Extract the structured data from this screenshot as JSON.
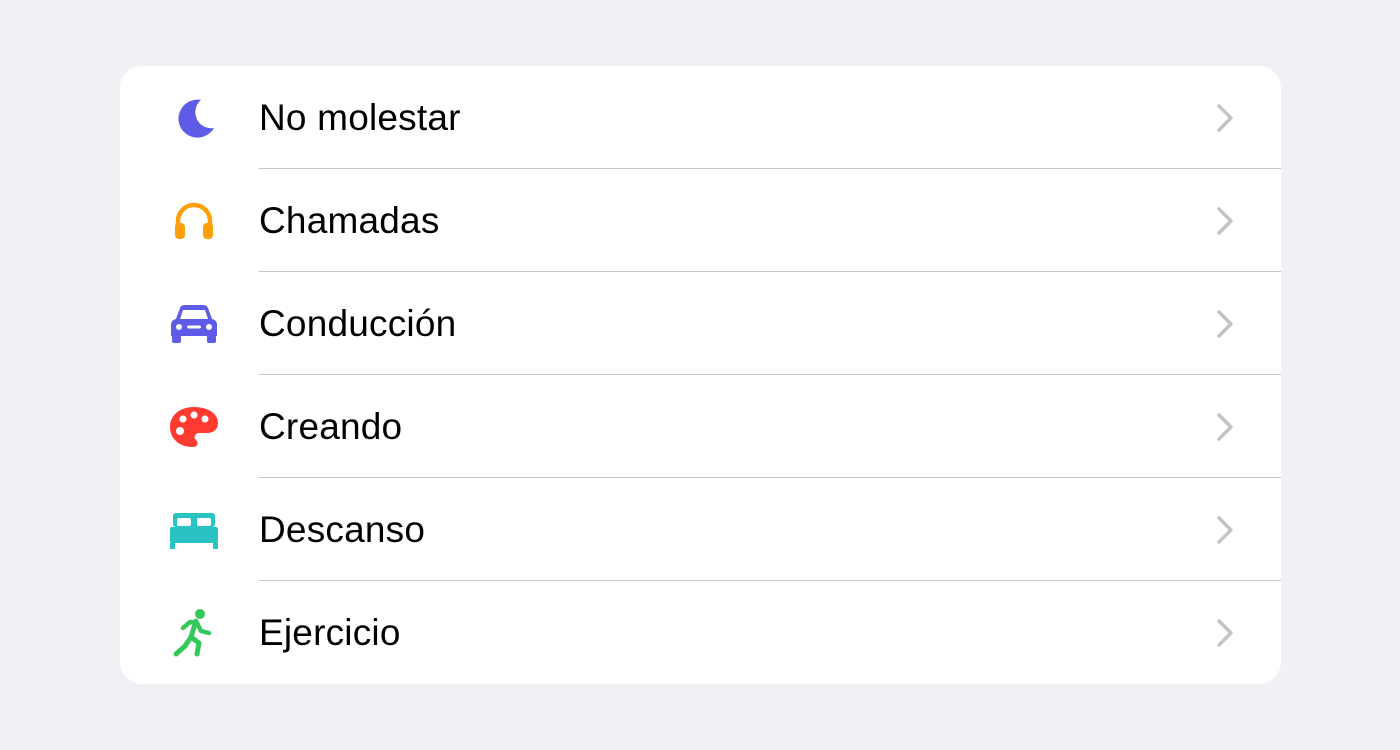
{
  "colors": {
    "background": "#f0f0f5",
    "card": "#ffffff",
    "separator": "#c8c8cc",
    "chevron": "#c4c4c7",
    "moon": "#5e5ce6",
    "headphones": "#ff9f0a",
    "car": "#5e5ce6",
    "palette": "#ff3b30",
    "bed": "#2ac3c3",
    "runner": "#34c759"
  },
  "focus_list": {
    "items": [
      {
        "label": "No molestar",
        "icon": "moon-icon"
      },
      {
        "label": "Chamadas",
        "icon": "headphones-icon"
      },
      {
        "label": "Conducción",
        "icon": "car-icon"
      },
      {
        "label": "Creando",
        "icon": "palette-icon"
      },
      {
        "label": "Descanso",
        "icon": "bed-icon"
      },
      {
        "label": "Ejercicio",
        "icon": "runner-icon"
      }
    ]
  }
}
